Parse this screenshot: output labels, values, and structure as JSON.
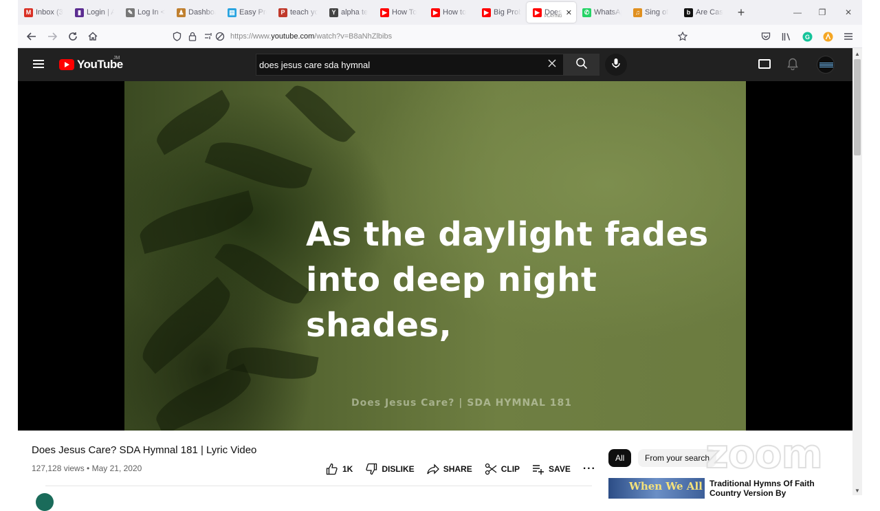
{
  "browser": {
    "tabs": [
      {
        "title": "Inbox (3",
        "icon": "gmail-icon",
        "color": "#d93025",
        "glyph": "M"
      },
      {
        "title": "Login | A",
        "icon": "chart-icon",
        "color": "#5c2d91",
        "glyph": "▮"
      },
      {
        "title": "Log In <",
        "icon": "wrench-icon",
        "color": "#777777",
        "glyph": "✎"
      },
      {
        "title": "Dashboa",
        "icon": "people-icon",
        "color": "#c08030",
        "glyph": "♟"
      },
      {
        "title": "Easy Pro",
        "icon": "doc-icon",
        "color": "#2aa4e0",
        "glyph": "▤"
      },
      {
        "title": "teach yo",
        "icon": "pd-icon",
        "color": "#c0392b",
        "glyph": "P"
      },
      {
        "title": "alpha te",
        "icon": "y-icon",
        "color": "#444444",
        "glyph": "Y"
      },
      {
        "title": "How To",
        "icon": "youtube-icon",
        "color": "#ff0000",
        "glyph": "▶"
      },
      {
        "title": "How to",
        "icon": "youtube-icon",
        "color": "#ff0000",
        "glyph": "▶"
      },
      {
        "title": "Big Prob",
        "icon": "youtube-icon",
        "color": "#ff0000",
        "glyph": "▶"
      },
      {
        "title": "Does",
        "icon": "youtube-icon",
        "color": "#ff0000",
        "glyph": "▶",
        "active": true,
        "sub": "PLAYING"
      },
      {
        "title": "WhatsAp",
        "icon": "whatsapp-icon",
        "color": "#25d366",
        "glyph": "✆"
      },
      {
        "title": "Sing of",
        "icon": "music-icon",
        "color": "#e09020",
        "glyph": "♫"
      },
      {
        "title": "Are Cas",
        "icon": "b-icon",
        "color": "#111111",
        "glyph": "b"
      }
    ],
    "url_prefix": "https://www.",
    "url_domain": "youtube.com",
    "url_path": "/watch?v=B8aNhZlbibs"
  },
  "youtube": {
    "logo_text": "YouTube",
    "region": "JM",
    "search_value": "does jesus care sda hymnal",
    "video": {
      "lyric_line1": "As the daylight fades",
      "lyric_line2": "into deep night shades,",
      "caption": "Does Jesus Care? |  SDA HYMNAL 181"
    },
    "title": "Does Jesus Care? SDA Hymnal 181 | Lyric Video",
    "meta": "127,128 views • May 21, 2020",
    "actions": {
      "like": "1K",
      "dislike": "DISLIKE",
      "share": "SHARE",
      "clip": "CLIP",
      "save": "SAVE",
      "more": "···"
    },
    "chips": {
      "all": "All",
      "from_search": "From your search"
    },
    "watermark": "zoom",
    "recommendation": {
      "thumb_text": "When We All",
      "title": "Traditional Hymns Of Faith Country Version By"
    }
  }
}
